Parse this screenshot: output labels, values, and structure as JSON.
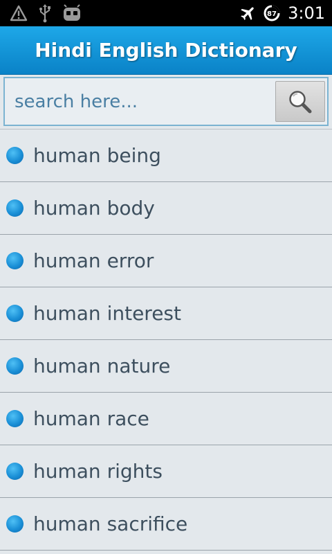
{
  "status_bar": {
    "time": "3:01",
    "battery_level": "87",
    "icons": [
      "warning-icon",
      "usb-icon",
      "android-debug-icon",
      "airplane-mode-icon",
      "battery-icon"
    ]
  },
  "header": {
    "title": "Hindi English Dictionary"
  },
  "search": {
    "placeholder": "search here...",
    "value": ""
  },
  "words": [
    {
      "label": "human being"
    },
    {
      "label": "human body"
    },
    {
      "label": "human error"
    },
    {
      "label": "human interest"
    },
    {
      "label": "human nature"
    },
    {
      "label": "human race"
    },
    {
      "label": "human rights"
    },
    {
      "label": "human sacrifice"
    }
  ],
  "colors": {
    "accent": "#0a8fd8",
    "background": "#e3e8ec",
    "bullet": "#1a8fd6"
  }
}
